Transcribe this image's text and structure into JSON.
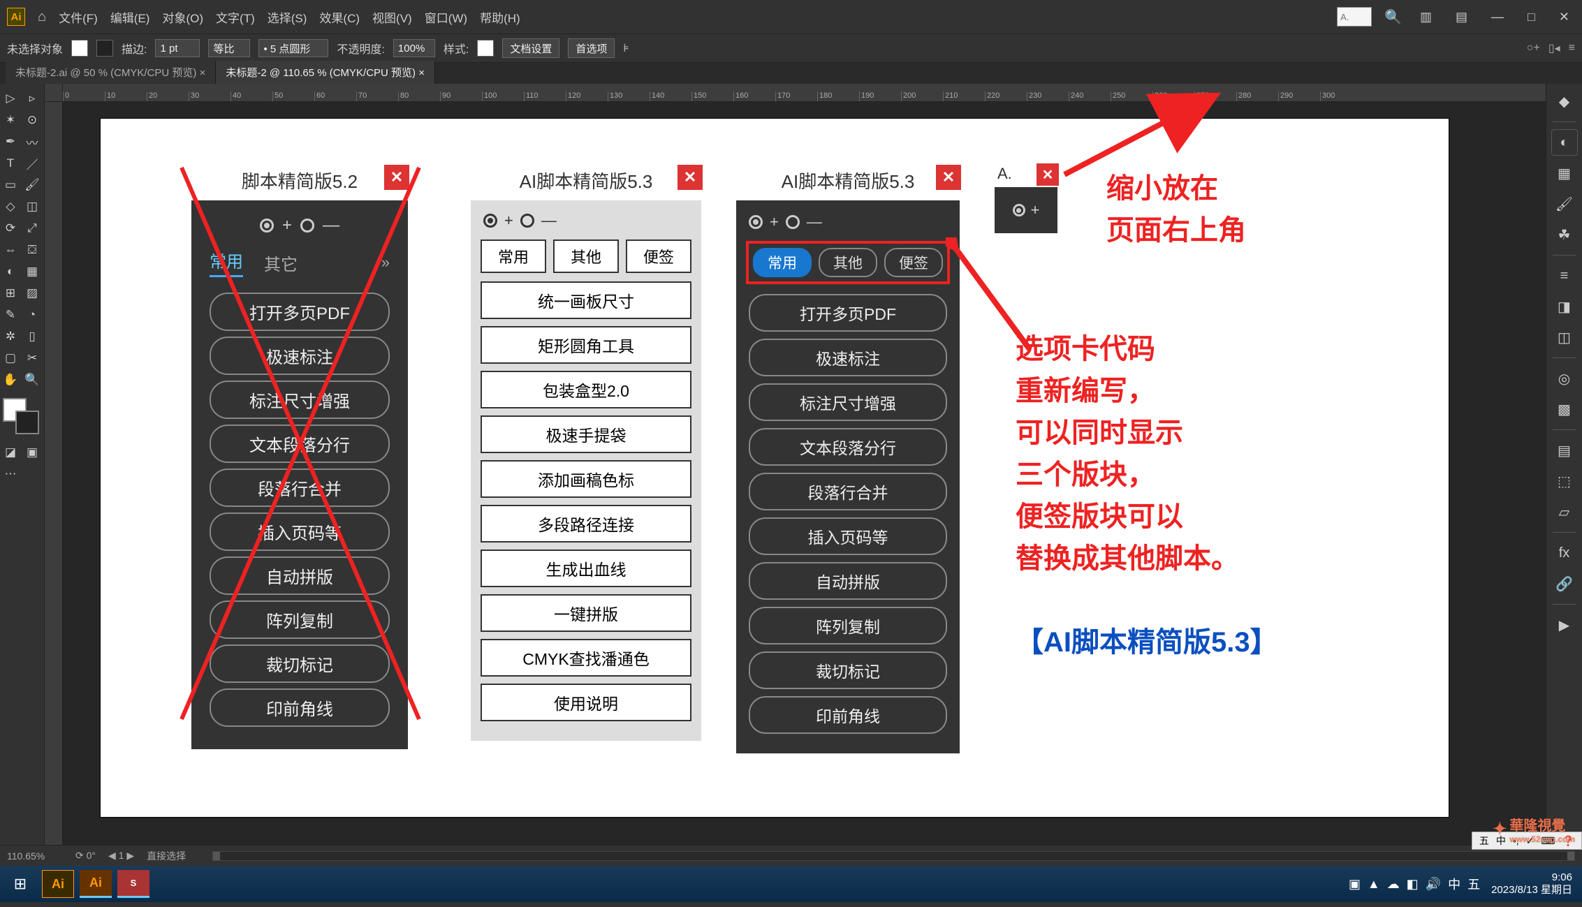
{
  "menubar": {
    "logo": "Ai",
    "items": [
      "文件(F)",
      "编辑(E)",
      "对象(O)",
      "文字(T)",
      "选择(S)",
      "效果(C)",
      "视图(V)",
      "窗口(W)",
      "帮助(H)"
    ],
    "top_search_placeholder": "A."
  },
  "controlbar": {
    "no_selection": "未选择对象",
    "stroke_label": "描边:",
    "stroke_value": "1 pt",
    "uniform": "等比",
    "corner_label": "• 5 点圆形",
    "opacity_label": "不透明度:",
    "opacity_value": "100%",
    "style_label": "样式:",
    "doc_setup": "文档设置",
    "prefs": "首选项"
  },
  "tabs": {
    "items": [
      {
        "label": "未标题-2.ai @ 50 % (CMYK/CPU 预览)",
        "active": false
      },
      {
        "label": "未标题-2 @ 110.65 % (CMYK/CPU 预览)",
        "active": true
      }
    ]
  },
  "ruler_marks": [
    "0",
    "10",
    "20",
    "30",
    "40",
    "50",
    "60",
    "70",
    "80",
    "90",
    "100",
    "110",
    "120",
    "130",
    "140",
    "150",
    "160",
    "170",
    "180",
    "190",
    "200",
    "210",
    "220",
    "230",
    "240",
    "250",
    "260",
    "270",
    "280",
    "290",
    "300"
  ],
  "panel52": {
    "title": "脚本精简版5.2",
    "tabs": [
      "常用",
      "其它"
    ],
    "buttons": [
      "打开多页PDF",
      "极速标注",
      "标注尺寸增强",
      "文本段落分行",
      "段落行合并",
      "插入页码等",
      "自动拼版",
      "阵列复制",
      "裁切标记",
      "印前角线"
    ]
  },
  "panel53_light": {
    "title": "AI脚本精简版5.3",
    "tabs": [
      "常用",
      "其他",
      "便签"
    ],
    "buttons": [
      "统一画板尺寸",
      "矩形圆角工具",
      "包装盒型2.0",
      "极速手提袋",
      "添加画稿色标",
      "多段路径连接",
      "生成出血线",
      "一键拼版",
      "CMYK查找潘通色",
      "使用说明"
    ]
  },
  "panel53_dark": {
    "title": "AI脚本精简版5.3",
    "tabs": [
      "常用",
      "其他",
      "便签"
    ],
    "buttons": [
      "打开多页PDF",
      "极速标注",
      "标注尺寸增强",
      "文本段落分行",
      "段落行合并",
      "插入页码等",
      "自动拼版",
      "阵列复制",
      "裁切标记",
      "印前角线"
    ]
  },
  "panel_mini": {
    "title": "A."
  },
  "annotations": {
    "top_right": "缩小放在\n页面右上角",
    "mid_right": "选项卡代码\n重新编写，\n可以同时显示\n三个版块，\n便签版块可以\n替换成其他脚本。",
    "bottom_right": "【AI脚本精简版5.3】"
  },
  "statusbar": {
    "zoom": "110.65%",
    "nav_label": "1",
    "tool_label": "直接选择"
  },
  "ime": [
    "五",
    "中",
    "•,",
    "✓",
    "⌨",
    "❓"
  ],
  "taskbar": {
    "tray_icons": [
      "▣",
      "▲",
      "☁",
      "◧",
      "🔊",
      "中",
      "五"
    ],
    "time": "9:06",
    "date": "2023/8/13 星期日"
  },
  "watermark": {
    "text": "華隆視覺",
    "sub": "www.52cnp.com"
  }
}
